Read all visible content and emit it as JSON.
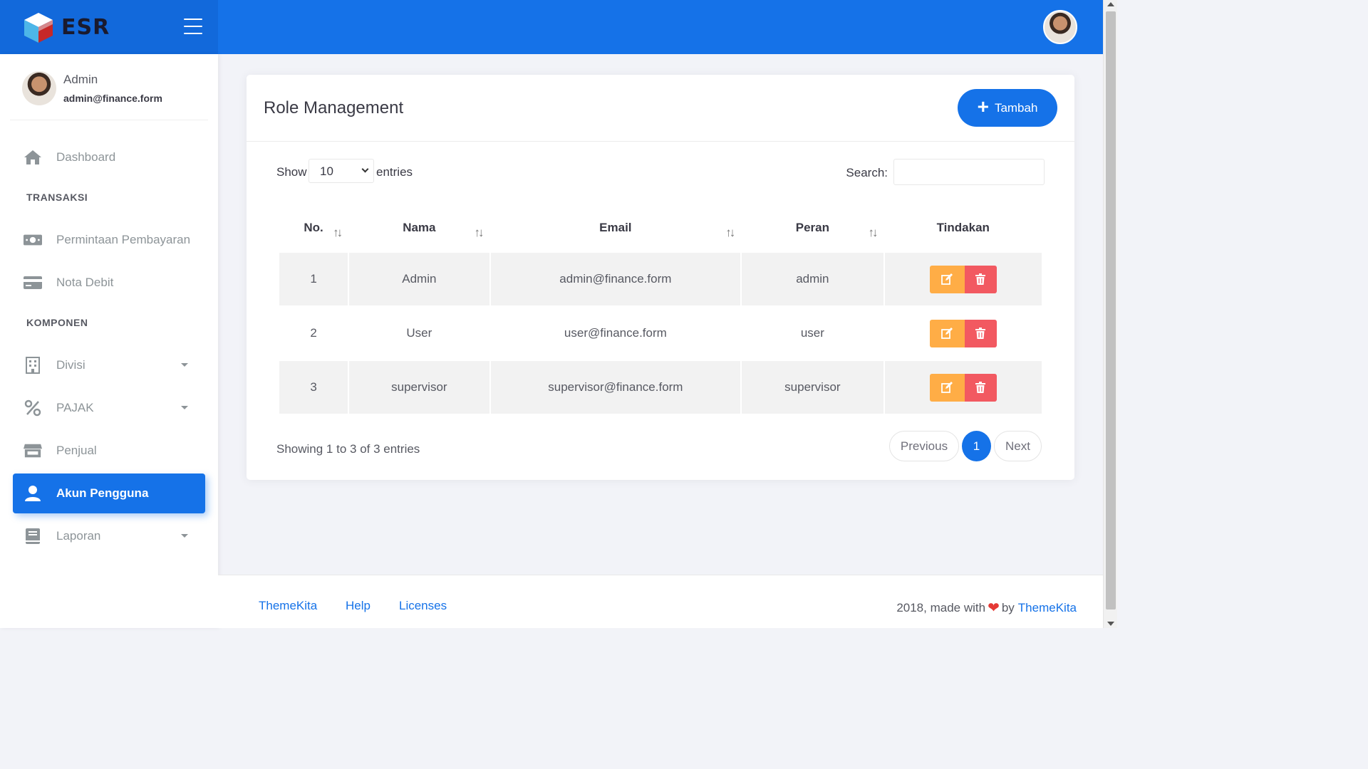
{
  "brand": {
    "name": "ESR"
  },
  "user": {
    "name": "Admin",
    "email": "admin@finance.form"
  },
  "sidebar": {
    "items": [
      {
        "label": "Dashboard",
        "icon": "home-icon"
      },
      {
        "section": "TRANSAKSI"
      },
      {
        "label": "Permintaan Pembayaran",
        "icon": "money-icon"
      },
      {
        "label": "Nota Debit",
        "icon": "credit-card-icon"
      },
      {
        "section": "KOMPONEN"
      },
      {
        "label": "Divisi",
        "icon": "building-icon",
        "has_submenu": true
      },
      {
        "label": "PAJAK",
        "icon": "percent-icon",
        "has_submenu": true
      },
      {
        "label": "Penjual",
        "icon": "store-icon"
      },
      {
        "label": "Akun Pengguna",
        "icon": "user-icon",
        "active": true
      },
      {
        "label": "Laporan",
        "icon": "book-icon",
        "has_submenu": true
      }
    ]
  },
  "card": {
    "title": "Role Management",
    "add_label": "Tambah",
    "show_label": "Show",
    "page_size": "10",
    "entries_label": "entries",
    "search_label": "Search:",
    "search_value": ""
  },
  "table": {
    "headers": [
      "No.",
      "Nama",
      "Email",
      "Peran",
      "Tindakan"
    ],
    "rows": [
      {
        "no": "1",
        "nama": "Admin",
        "email": "admin@finance.form",
        "peran": "admin"
      },
      {
        "no": "2",
        "nama": "User",
        "email": "user@finance.form",
        "peran": "user"
      },
      {
        "no": "3",
        "nama": "supervisor",
        "email": "supervisor@finance.form",
        "peran": "supervisor"
      }
    ]
  },
  "pagination": {
    "info": "Showing 1 to 3 of 3 entries",
    "previous": "Previous",
    "current": "1",
    "next": "Next"
  },
  "footer": {
    "links": [
      "ThemeKita",
      "Help",
      "Licenses"
    ],
    "credit_prefix": "2018, made with",
    "credit_by": "by",
    "credit_link": "ThemeKita"
  },
  "colors": {
    "primary": "#1572e8",
    "warning": "#ffad46",
    "danger": "#f25961"
  }
}
